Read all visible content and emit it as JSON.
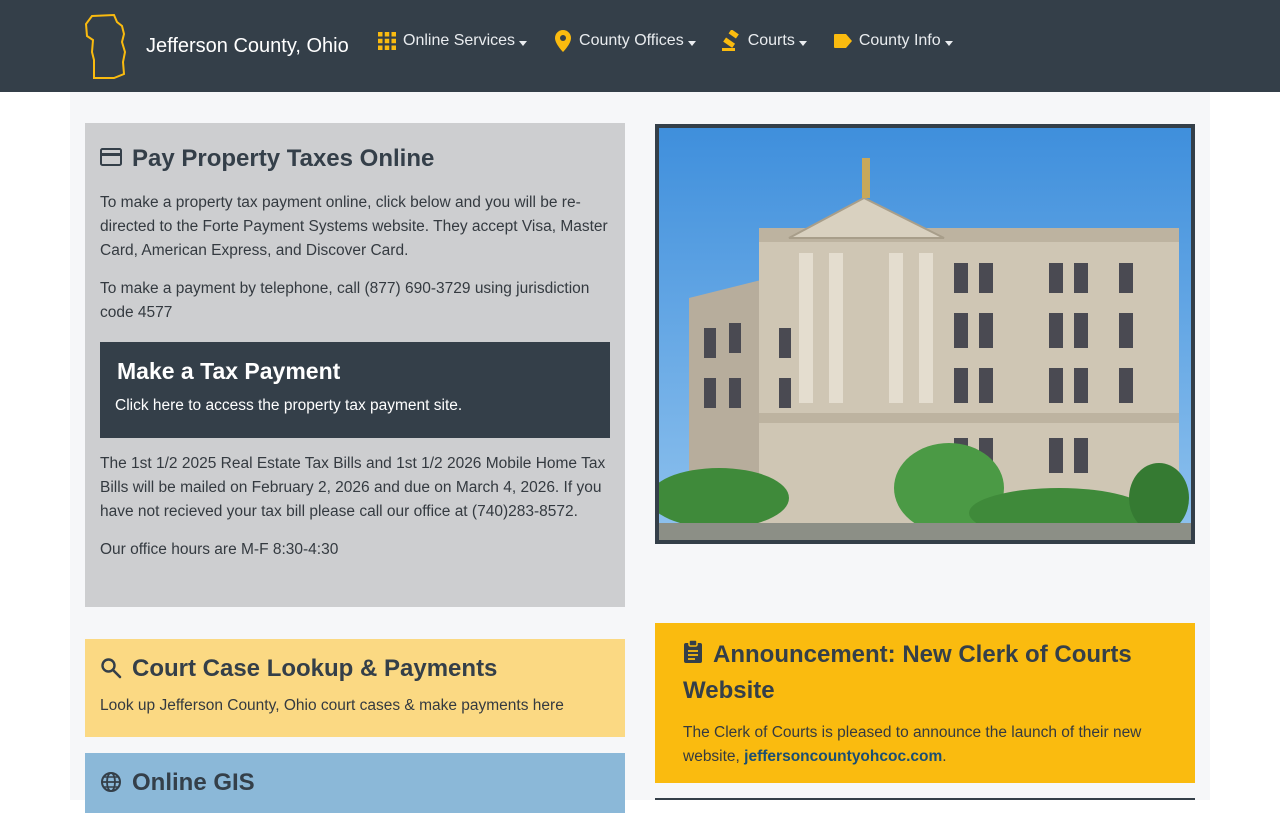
{
  "header": {
    "site_title": "Jefferson County, Ohio",
    "nav": [
      {
        "label": "Online Services",
        "icon": "grid-icon"
      },
      {
        "label": "County Offices",
        "icon": "map-pin-icon"
      },
      {
        "label": "Courts",
        "icon": "gavel-icon"
      },
      {
        "label": "County Info",
        "icon": "tag-icon"
      }
    ]
  },
  "colors": {
    "navbar": "#343f49",
    "accent": "#fabb0f",
    "gray_card": "#cdced0",
    "yellow_card": "#fbd983",
    "blue_card": "#8bb8d8"
  },
  "property_taxes": {
    "title": "Pay Property Taxes Online",
    "intro": "To make a property tax payment online, click below and you will be re-directed to the Forte Payment Systems website. They accept Visa, Master Card, American Express, and Discover Card.",
    "phone_text": "To make a payment by telephone, call (877) 690-3729 using jurisdiction code 4577",
    "pay_box_title": "Make a Tax Payment",
    "pay_box_text": "Click here to access the property tax payment site.",
    "bills_text": "The 1st 1/2 2025 Real Estate Tax Bills and 1st 1/2 2026 Mobile Home Tax Bills will be mailed on February 2, 2026 and due on March 4, 2026. If you have not recieved your tax bill please call our office at (740)283-8572.",
    "hours_text": "Our office hours are M-F 8:30-4:30"
  },
  "court_lookup": {
    "title": "Court Case Lookup & Payments",
    "text": "Look up Jefferson County, Ohio court cases & make payments here"
  },
  "gis": {
    "title": "Online GIS"
  },
  "announcement": {
    "title": "Announcement: New Clerk of Courts Website",
    "text_before": "The Clerk of Courts is pleased to announce the launch of their new website, ",
    "link_text": "jeffersoncountyohcoc.com",
    "text_after": "."
  }
}
